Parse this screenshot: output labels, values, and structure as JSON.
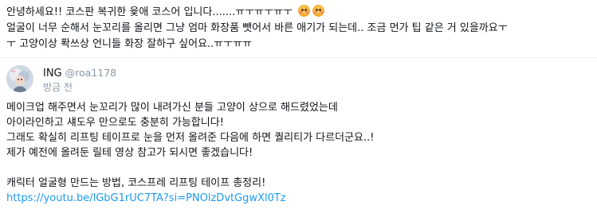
{
  "question": {
    "lines": [
      "안녕하세요!! 코스판 복귀한 윷애 코스어 입니다.......ㅠㅜㅠㅜㅠㅜ",
      "얼굴이 너무 순해서 눈꼬리를 올리면 그냥 엄마 화장품 뺏어서 바른 애기가 되는데.. 조금 먼가 팁 같은 거 있을까요ㅜ",
      "ㅜ 고양이상 퐉쓰상 언니들 화장 잘하구 싶어요..ㅠㅜㅠㅠ"
    ],
    "emojis": [
      "pleading-face-icon",
      "pleading-face-icon"
    ]
  },
  "reply": {
    "display_name": "ING",
    "handle": "@roa1178",
    "timestamp": "방금 전",
    "lines": [
      "메이크업 해주면서 눈꼬리가 많이 내려가신 분들 고양이 상으로 해드렸었는데",
      "아이라인하고 섀도우 만으로도 충분히 가능합니다!",
      "그래도 확실히 리프팅 테이프로 눈을 먼저 올려준 다음에 하면 퀄리티가 다르더군요..!",
      "제가 예전에 올려둔 릴테 영상 참고가 되시면 좋겠습니다!"
    ],
    "title_line": "캐릭터 얼굴형 만드는 방법, 코스프레 리프팅 테이프 총정리!",
    "link": "https://youtu.be/lGbG1rUC7TA?si=PNOlzDvtGgwXl0Tz"
  },
  "colors": {
    "text": "#0f1419",
    "muted": "#8899a6",
    "link": "#1d9bf0",
    "divider": "#eff3f4"
  }
}
